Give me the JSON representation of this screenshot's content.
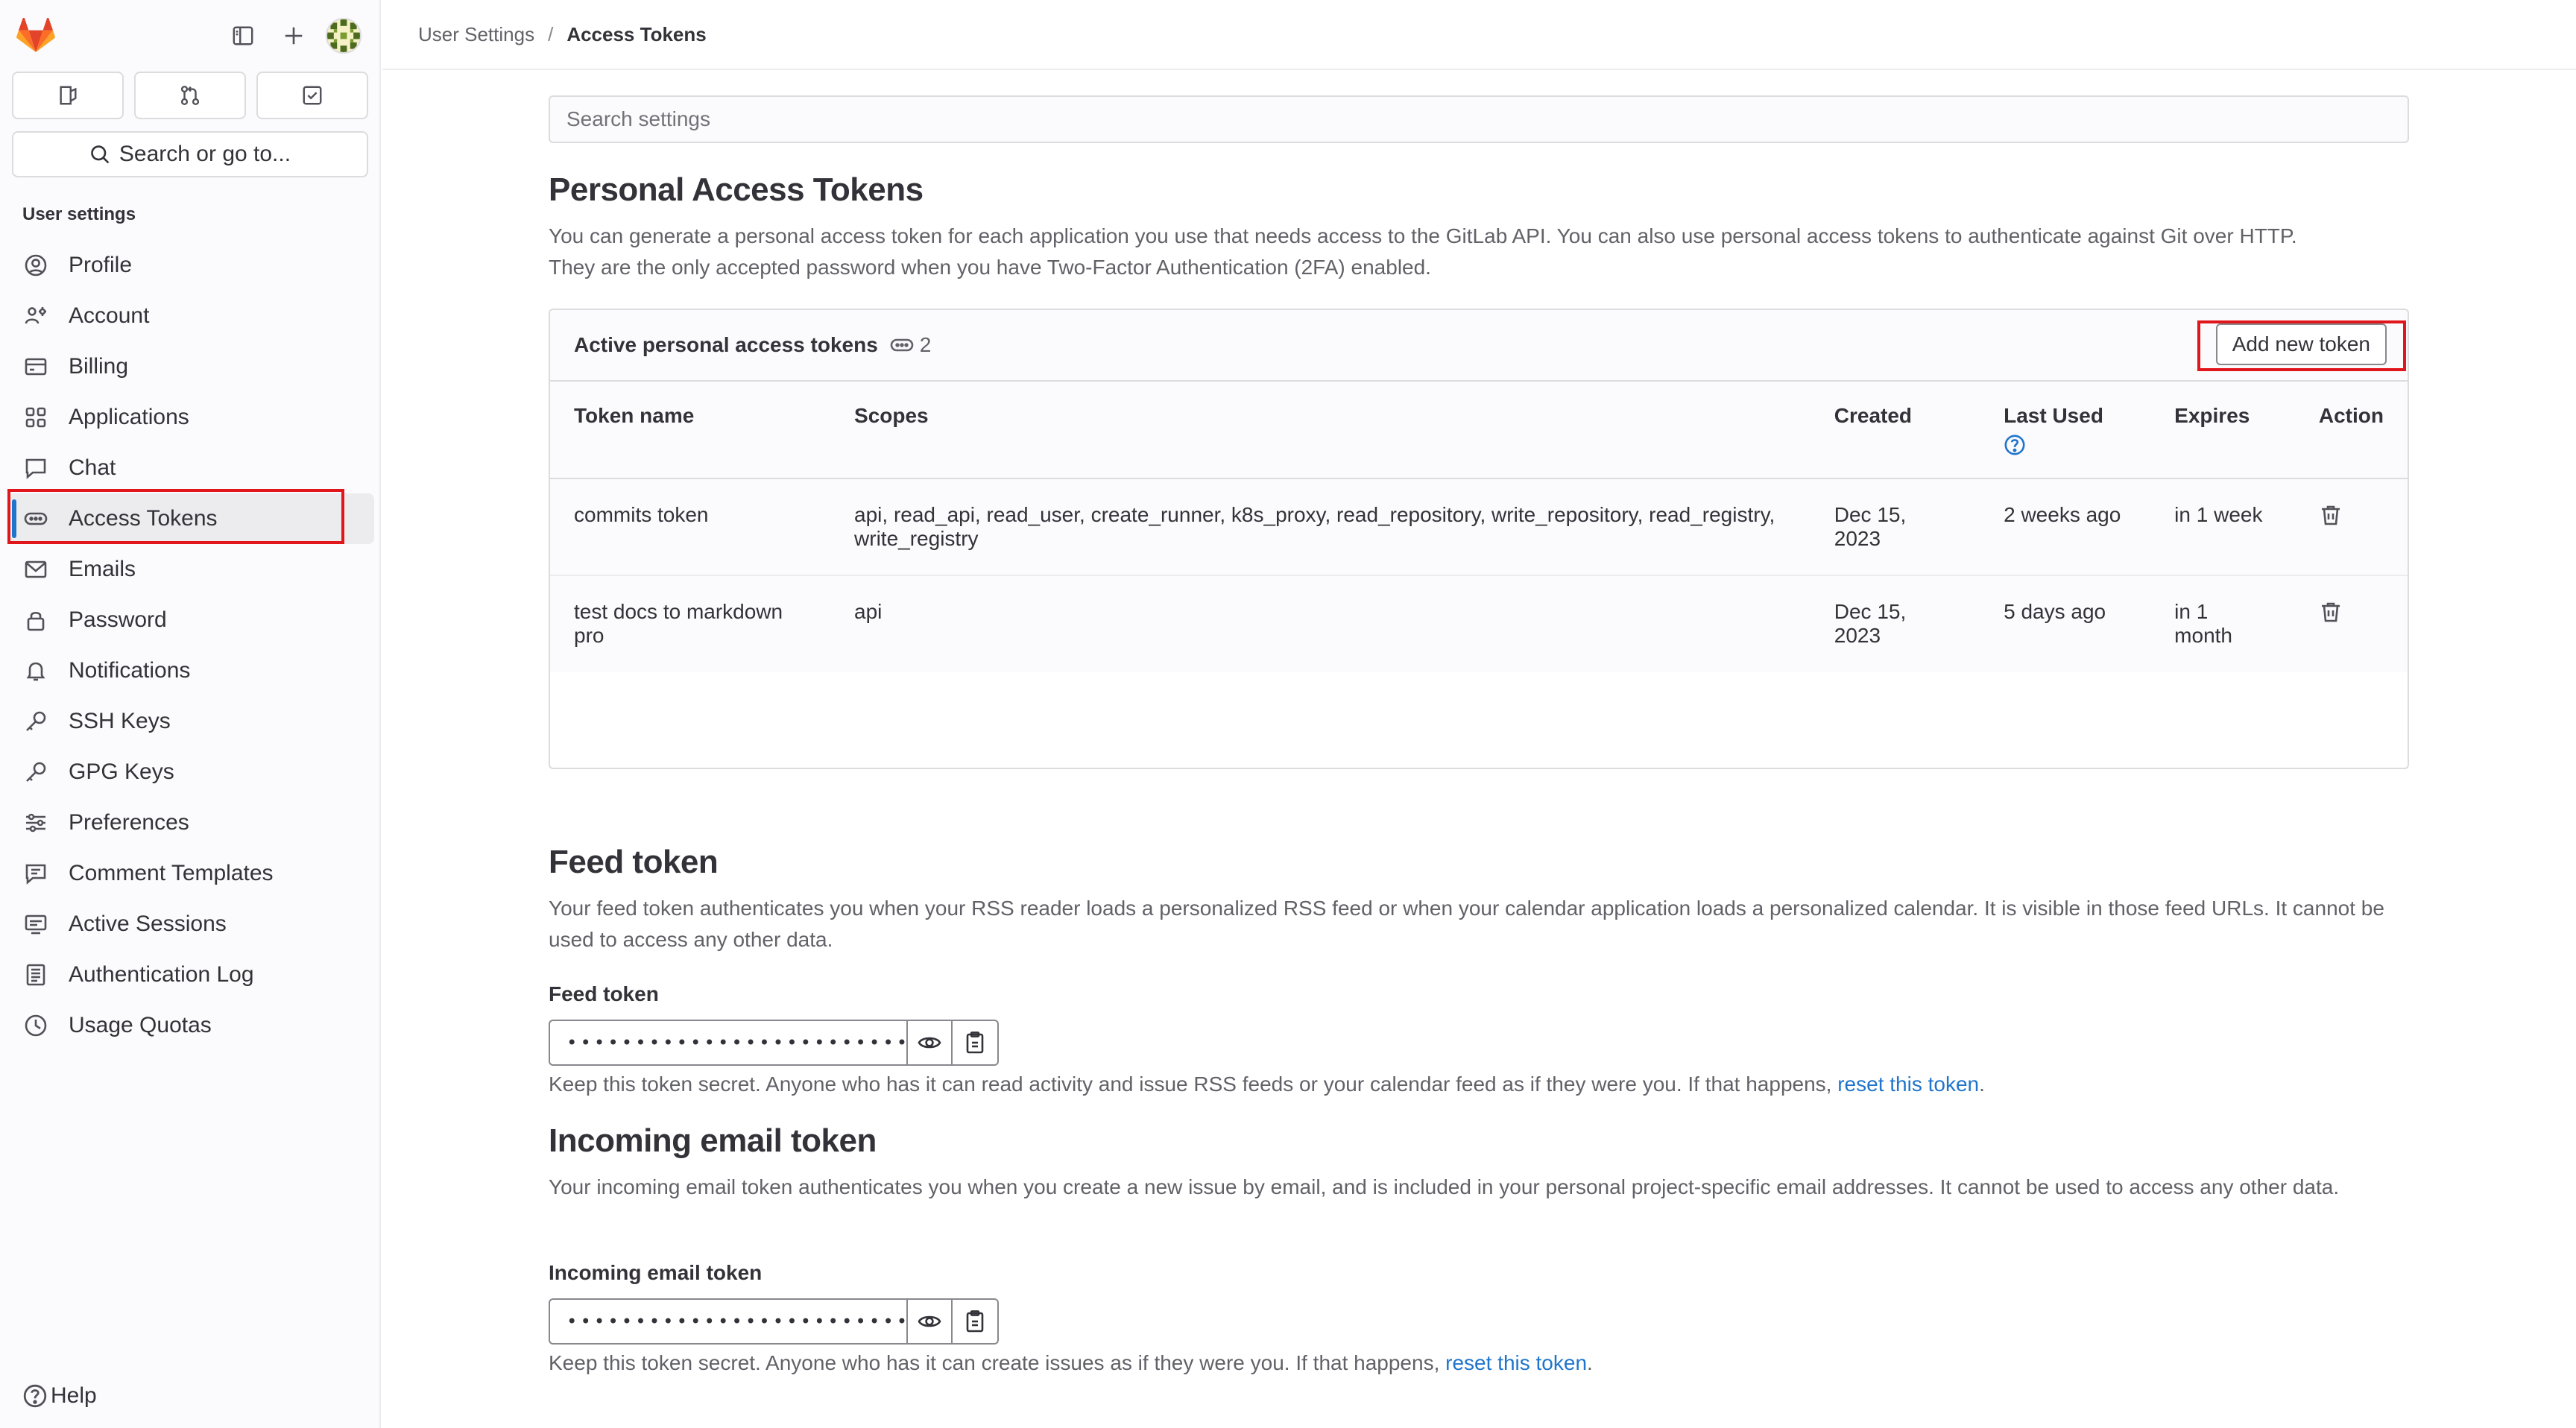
{
  "sidebar": {
    "heading": "User settings",
    "items": [
      {
        "label": "Profile",
        "icon": "profile-icon"
      },
      {
        "label": "Account",
        "icon": "account-icon"
      },
      {
        "label": "Billing",
        "icon": "billing-icon"
      },
      {
        "label": "Applications",
        "icon": "applications-icon"
      },
      {
        "label": "Chat",
        "icon": "chat-icon"
      },
      {
        "label": "Access Tokens",
        "icon": "token-icon",
        "active": true
      },
      {
        "label": "Emails",
        "icon": "mail-icon"
      },
      {
        "label": "Password",
        "icon": "lock-icon"
      },
      {
        "label": "Notifications",
        "icon": "bell-icon"
      },
      {
        "label": "SSH Keys",
        "icon": "key-icon"
      },
      {
        "label": "GPG Keys",
        "icon": "key-icon"
      },
      {
        "label": "Preferences",
        "icon": "preferences-icon"
      },
      {
        "label": "Comment Templates",
        "icon": "comment-icon"
      },
      {
        "label": "Active Sessions",
        "icon": "monitor-icon"
      },
      {
        "label": "Authentication Log",
        "icon": "log-icon"
      },
      {
        "label": "Usage Quotas",
        "icon": "quota-icon"
      }
    ],
    "search_label": "Search or go to...",
    "help_label": "Help"
  },
  "breadcrumb": {
    "parent": "User Settings",
    "current": "Access Tokens"
  },
  "search": {
    "placeholder": "Search settings"
  },
  "pat": {
    "title": "Personal Access Tokens",
    "desc_line1": "You can generate a personal access token for each application you use that needs access to the GitLab API. You can also use personal access tokens to authenticate against Git over HTTP.",
    "desc_line2": "They are the only accepted password when you have Two-Factor Authentication (2FA) enabled.",
    "card_title": "Active personal access tokens",
    "count": "2",
    "add_button": "Add new token",
    "columns": {
      "name": "Token name",
      "scopes": "Scopes",
      "created": "Created",
      "last_used": "Last Used",
      "expires": "Expires",
      "action": "Action"
    },
    "rows": [
      {
        "name": "commits token",
        "scopes": "api, read_api, read_user, create_runner, k8s_proxy, read_repository, write_repository, read_registry, write_registry",
        "created": "Dec 15, 2023",
        "last_used": "2 weeks ago",
        "expires": "in 1 week"
      },
      {
        "name": "test docs to markdown pro",
        "scopes": "api",
        "created": "Dec 15, 2023",
        "last_used": "5 days ago",
        "expires": "in 1 month"
      }
    ]
  },
  "feed": {
    "title": "Feed token",
    "desc": "Your feed token authenticates you when your RSS reader loads a personalized RSS feed or when your calendar application loads a personalized calendar. It is visible in those feed URLs. It cannot be used to access any other data.",
    "label": "Feed token",
    "value": "••••••••••••••••••••••••••",
    "hint": "Keep this token secret. Anyone who has it can read activity and issue RSS feeds or your calendar feed as if they were you. If that happens,",
    "hint_link": "reset this token",
    "hint_end": "."
  },
  "incoming": {
    "title": "Incoming email token",
    "desc": "Your incoming email token authenticates you when you create a new issue by email, and is included in your personal project-specific email addresses. It cannot be used to access any other data.",
    "label": "Incoming email token",
    "value": "••••••••••••••••••••••••••",
    "hint": "Keep this token secret. Anyone who has it can create issues as if they were you. If that happens,",
    "hint_link": "reset this token",
    "hint_end": "."
  },
  "colors": {
    "brand": "#fc6d26",
    "link": "#1f75cb",
    "highlight": "#e0161b"
  }
}
